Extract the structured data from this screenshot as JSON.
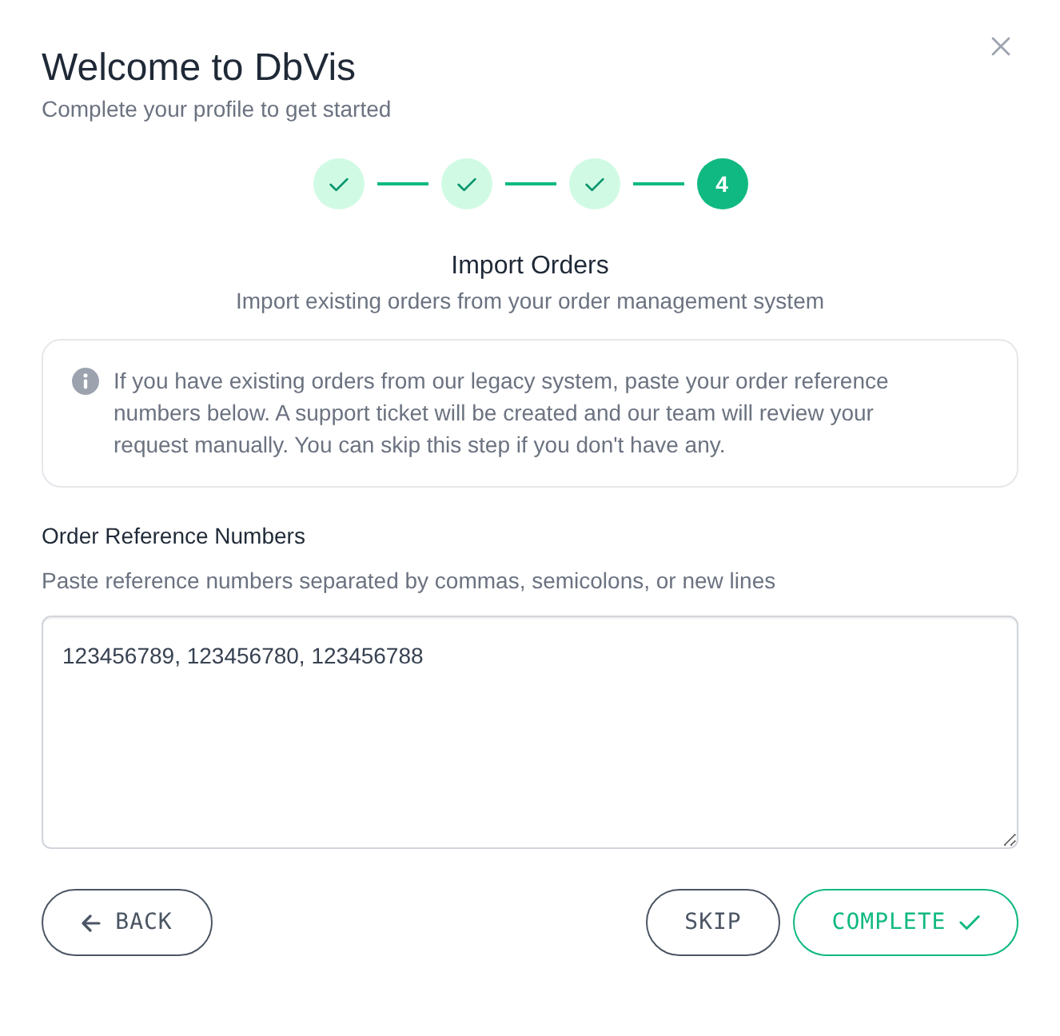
{
  "dialog": {
    "title": "Welcome to DbVis",
    "subtitle": "Complete your profile to get started"
  },
  "steps": [
    {
      "completed": true
    },
    {
      "completed": true
    },
    {
      "completed": true
    },
    {
      "completed": false,
      "label": "4"
    }
  ],
  "section": {
    "title": "Import Orders",
    "subtitle": "Import existing orders from your order management system"
  },
  "info": {
    "text": "If you have existing orders from our legacy system, paste your order reference numbers below. A support ticket will be created and our team will review your request manually. You can skip this step if you don't have any."
  },
  "field": {
    "label": "Order Reference Numbers",
    "hint": "Paste reference numbers separated by commas, semicolons, or new lines",
    "value": "123456789, 123456780, 123456788"
  },
  "buttons": {
    "back": {
      "label": "BACK"
    },
    "skip": {
      "label": "SKIP"
    },
    "complete": {
      "label": "COMPLETE"
    }
  }
}
